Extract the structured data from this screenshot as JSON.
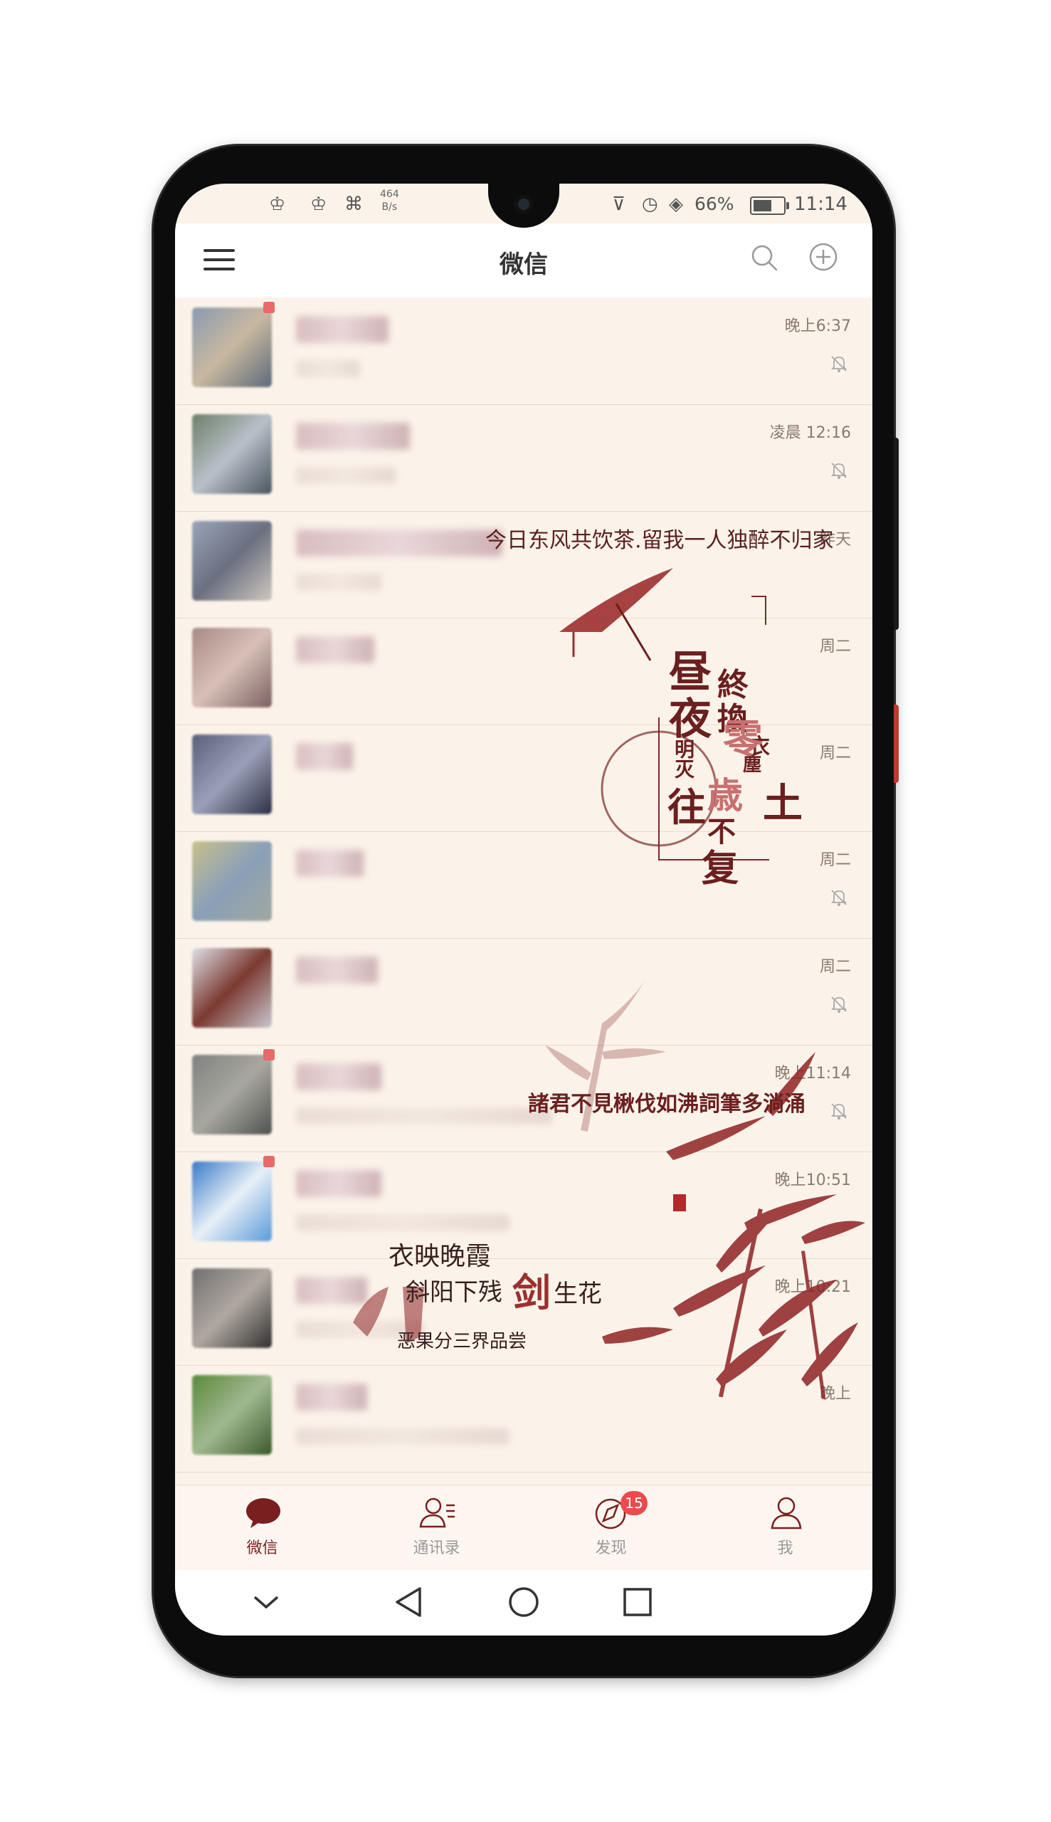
{
  "status_bar": {
    "net_speed_value": "464",
    "net_speed_unit": "B/s",
    "battery_percent": "66%",
    "battery_level": 0.66,
    "time": "11:14"
  },
  "header": {
    "title": "微信",
    "menu_icon": "menu-icon",
    "search_icon": "search-icon",
    "add_icon": "add-icon"
  },
  "chats": [
    {
      "time": "晚上6:37",
      "muted": true,
      "unread": true
    },
    {
      "time": "凌晨 12:16",
      "muted": true,
      "unread": false
    },
    {
      "time": "昨天",
      "muted": false,
      "unread": false
    },
    {
      "time": "周二",
      "muted": false,
      "unread": false
    },
    {
      "time": "周二",
      "muted": false,
      "unread": false
    },
    {
      "time": "周二",
      "muted": true,
      "unread": false
    },
    {
      "time": "周二",
      "muted": true,
      "unread": false
    },
    {
      "time": "晚上11:14",
      "muted": true,
      "unread": true
    },
    {
      "time": "晚上10:51",
      "muted": false,
      "unread": true
    },
    {
      "time": "晚上10:21",
      "muted": false,
      "unread": false
    },
    {
      "time": "晚上",
      "muted": false,
      "unread": false
    }
  ],
  "theme_text": {
    "line1": "今日东风共饮茶.留我一人独醉不归家",
    "poem_main": [
      "昼",
      "夜"
    ],
    "poem_sub1": "明灭",
    "poem_col2": [
      "終",
      "換"
    ],
    "poem_col2b": [
      "衣"
    ],
    "poem_col3": [
      "往"
    ],
    "poem_col4": [
      "歳",
      "不",
      "复"
    ],
    "poem_col5": [
      "零",
      "塵",
      "土"
    ],
    "line2": "諸君不見楸伐如沸詞筆多淌涌",
    "line3a": "衣映晚霞",
    "line3b": "斜阳下残",
    "line3c": "剑",
    "line3d": "生花",
    "line4": "恶果分三界品尝"
  },
  "tabs": [
    {
      "label": "微信",
      "icon": "chat-bubble-icon",
      "active": true
    },
    {
      "label": "通讯录",
      "icon": "contacts-icon",
      "active": false
    },
    {
      "label": "发现",
      "icon": "discover-compass-icon",
      "active": false,
      "badge": "15"
    },
    {
      "label": "我",
      "icon": "profile-icon",
      "active": false
    }
  ],
  "navigation_bar": {
    "buttons": [
      "collapse-chevron-icon",
      "back-triangle-icon",
      "home-circle-icon",
      "recents-square-icon"
    ]
  },
  "colors": {
    "accent": "#7a1f1f",
    "background": "#fbf3ea",
    "badge": "#e84c4c"
  }
}
